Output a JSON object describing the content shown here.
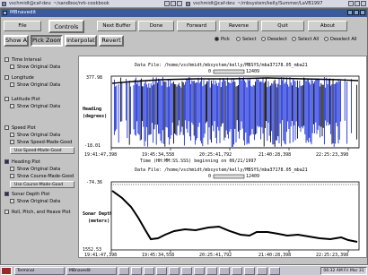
{
  "background_windows": [
    {
      "title": "vschmidt@caf-dev: ~/sandbox/nrk-cookbook"
    },
    {
      "title": "vschmidt@caf-dev: ~/mbsystem/kelly/Summer/LaVB1997"
    }
  ],
  "window": {
    "title": "MBnavedit"
  },
  "toolbar": {
    "file": "File",
    "controls": "Controls",
    "next_buffer": "Next Buffer",
    "done": "Done",
    "forward": "Forward",
    "reverse": "Reverse",
    "quit": "Quit",
    "about": "About",
    "show_all": "Show All",
    "pick_zoom": "Pick Zoom",
    "interpolate": "Interpolate",
    "revert": "Revert"
  },
  "mode": {
    "pick": "Pick",
    "select": "Select",
    "deselect": "Deselect",
    "select_all": "Select All",
    "deselect_all": "Deselect All"
  },
  "left_panel": {
    "time_interval": "Time Interval",
    "longitude": "Longitude",
    "latitude_plot": "Latitude Plot",
    "show_original_data": "Show Original Data",
    "speed_plot": "Speed Plot",
    "show_speed_made_good": "Show Speed-Made-Good",
    "use_speed_made_good": "Use Speed-Made-Good",
    "heading_plot": "Heading Plot",
    "show_course_made_good": "Show Course-Made-Good",
    "use_course_made_good": "Use Course-Made-Good",
    "sonar_depth_plot": "Sonar Depth Plot",
    "roll_pitch_heave": "Roll, Pitch, and Heave Plot"
  },
  "plot1": {
    "data_file": "Data File: /home/vschmidt/mbsystem/kelly/MBSYS/mba37178.05_mba21",
    "ymax": "377.98",
    "ymin": "-18.01",
    "ylabel1": "Heading",
    "ylabel2": "(degrees)",
    "page_left": "0",
    "page_right": "12409",
    "xticks": [
      "19:41:47,398",
      "19:45:34,558",
      "20:25:41,792",
      "21:40:28,398",
      "22:25:23,398"
    ],
    "xlabel": "Time (HH:MM:SS.SSS) beginning on 06/21/1997",
    "colors": {
      "series": "#1a2fd8",
      "edited": "#000000"
    }
  },
  "plot2": {
    "data_file": "Data File: /home/vschmidt/mbsystem/kelly/MBSYS/mba37178.05_mba21",
    "ymin": "-74.36",
    "ymax": "1552.53",
    "ylabel1": "Sonar Depth",
    "ylabel2": "(meters)",
    "page_left": "0",
    "page_right": "12409",
    "xticks": [
      "19:41:47,398",
      "19:45:34,558",
      "20:25:41,792",
      "21:40:28,398",
      "22:25:23,398"
    ]
  },
  "taskbar": {
    "items": [
      "Terminal",
      "MBnavedit"
    ],
    "clock": "06:32 AM Fri Mar 31"
  }
}
